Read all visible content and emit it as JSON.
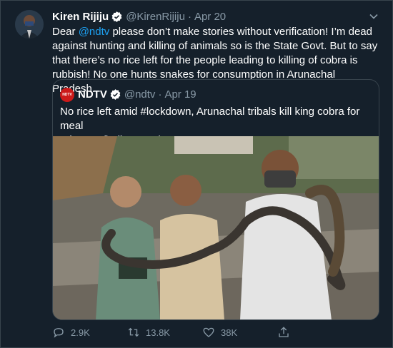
{
  "tweet": {
    "author_name": "Kiren Rijiju",
    "author_handle": "@KirenRijiju",
    "separator": "·",
    "timestamp": "Apr 20",
    "text_prefix": "Dear ",
    "mention": "@ndtv",
    "text_suffix": " please don’t make stories without verification! I’m dead against hunting and killing of animals so is the State Govt. But to say that there’s no rice left for the people leading to killing of cobra is rubbish! No one hunts snakes for consumption in Arunachal Pradesh."
  },
  "quote": {
    "author_name": "NDTV",
    "author_handle": "@ndtv",
    "separator": "·",
    "timestamp": "Apr 19",
    "avatar_text": "NDTV",
    "text_line1": "No rice left amid #lockdown, Arunachal tribals kill king cobra for meal",
    "text_line2": "ndtv.com/india-news/cor..."
  },
  "actions": {
    "reply_count": "2.9K",
    "retweet_count": "13.8K",
    "like_count": "38K"
  },
  "colors": {
    "background": "#15202b",
    "border": "#38444d",
    "muted": "#8899a6",
    "accent": "#1da1f2"
  },
  "icons": {
    "verified": "verified-badge-icon",
    "more": "chevron-down-icon",
    "reply": "reply-icon",
    "retweet": "retweet-icon",
    "like": "heart-icon",
    "share": "share-icon"
  }
}
